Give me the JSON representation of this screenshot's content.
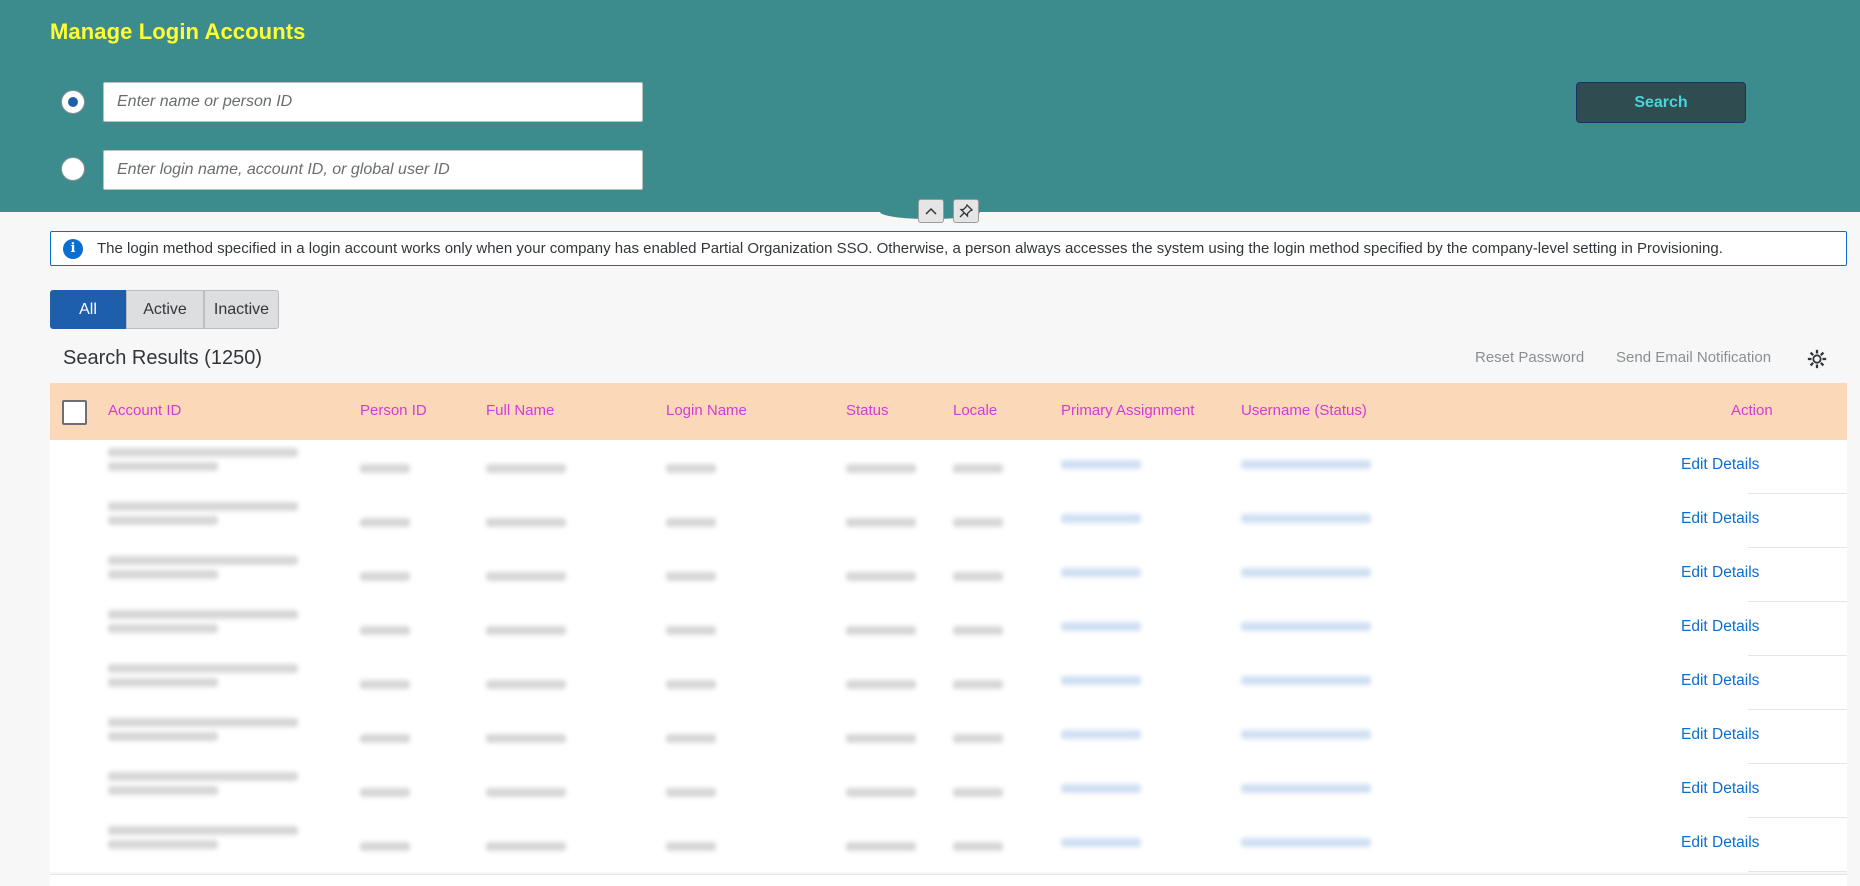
{
  "header": {
    "title": "Manage Login Accounts",
    "name_input_placeholder": "Enter name or person ID",
    "login_input_placeholder": "Enter login name, account ID, or global user ID",
    "search_label": "Search"
  },
  "info": {
    "message": "The login method specified in a login account works only when your company has enabled Partial Organization SSO. Otherwise, a person always accesses the system using the login method specified by the company-level setting in Provisioning."
  },
  "filters": {
    "items": [
      "All",
      "Active",
      "Inactive"
    ],
    "selected": "All"
  },
  "results": {
    "title": "Search Results (1250)",
    "reset_password": "Reset Password",
    "send_email": "Send Email Notification"
  },
  "table": {
    "columns": [
      "Account ID",
      "Person ID",
      "Full Name",
      "Login Name",
      "Status",
      "Locale",
      "Primary Assignment",
      "Username (Status)",
      "Action"
    ],
    "rows": [
      {
        "action": "Edit Details"
      },
      {
        "action": "Edit Details"
      },
      {
        "action": "Edit Details"
      },
      {
        "action": "Edit Details"
      },
      {
        "action": "Edit Details"
      },
      {
        "action": "Edit Details"
      },
      {
        "action": "Edit Details"
      },
      {
        "action": "Edit Details"
      }
    ]
  },
  "colors": {
    "header_bg": "#3d8c8d",
    "title": "#ffff33",
    "table_header_bg": "#fbd8b8",
    "column_text": "#d43bd6",
    "link": "#0a6ed1"
  }
}
